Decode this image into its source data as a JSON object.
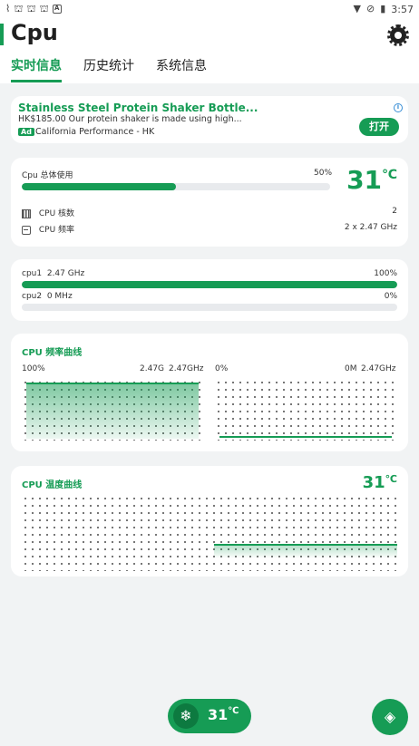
{
  "status_bar": {
    "time": "3:57",
    "left_icons": [
      "pulse-icon",
      "bug-icon",
      "bug-icon",
      "bug-icon",
      "a-box-icon"
    ],
    "right_icons": [
      "wifi-icon",
      "no-signal-icon",
      "battery-icon"
    ]
  },
  "header": {
    "title": "Cpu",
    "tabs": [
      {
        "label": "实时信息",
        "active": true
      },
      {
        "label": "历史统计",
        "active": false
      },
      {
        "label": "系统信息",
        "active": false
      }
    ]
  },
  "ad": {
    "title": "Stainless Steel Protein Shaker Bottle...",
    "description": "HK$185.00 Our protein shaker is made using high...",
    "tag": "Ad",
    "source": "California Performance - HK",
    "info": "i",
    "cta": "打开"
  },
  "usage": {
    "label": "Cpu 总体使用",
    "percent_text": "50%",
    "percent": 0.5,
    "temp_value": "31",
    "temp_unit": "℃",
    "cores_label": "CPU 核数",
    "cores_value": "2",
    "freq_label": "CPU 频率",
    "freq_value": "2 x 2.47 GHz"
  },
  "cores": [
    {
      "name": "cpu1",
      "freq": "2.47 GHz",
      "percent_text": "100%",
      "percent": 1.0
    },
    {
      "name": "cpu2",
      "freq": "0 MHz",
      "percent_text": "0%",
      "percent": 0.0
    }
  ],
  "freq_chart": {
    "title": "CPU 频率曲线",
    "left": {
      "percent": "100%",
      "current": "2.47G",
      "max": "2.47GHz"
    },
    "right": {
      "percent": "0%",
      "current": "0M",
      "max": "2.47GHz"
    }
  },
  "temp_chart": {
    "title": "CPU 温度曲线",
    "value": "31",
    "unit": "℃"
  },
  "bottom": {
    "icon": "snowflake-icon",
    "temp_value": "31",
    "temp_unit": "℃",
    "fab_icon": "layers-icon"
  },
  "colors": {
    "accent": "#169c55",
    "background": "#f1f3f4"
  }
}
